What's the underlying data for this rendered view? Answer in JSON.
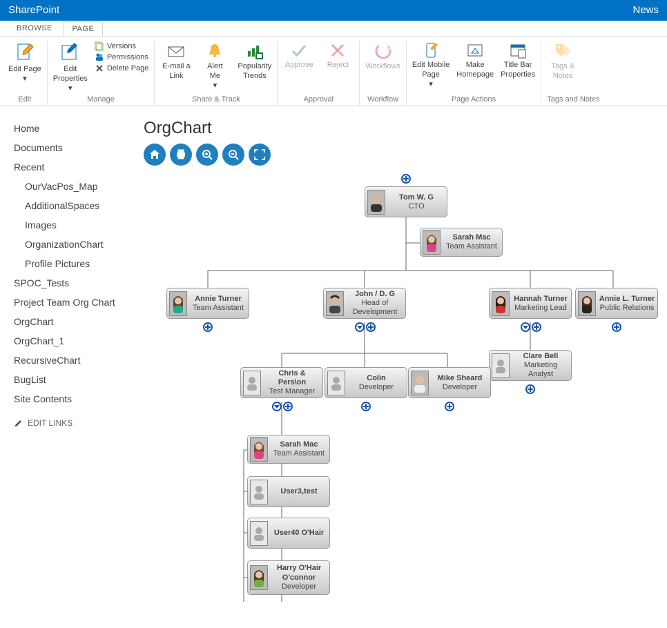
{
  "brand": "SharePoint",
  "topright": "News",
  "tabs": {
    "browse": "BROWSE",
    "page": "PAGE"
  },
  "ribbon": {
    "edit": {
      "label": "Edit",
      "editpage": "Edit Page"
    },
    "manage": {
      "label": "Manage",
      "editprops": "Edit\nProperties",
      "versions": "Versions",
      "permissions": "Permissions",
      "deletepage": "Delete Page"
    },
    "sharetrack": {
      "label": "Share & Track",
      "email": "E-mail a\nLink",
      "alert": "Alert\nMe",
      "trends": "Popularity\nTrends"
    },
    "approval": {
      "label": "Approval",
      "approve": "Approve",
      "reject": "Reject"
    },
    "workflow": {
      "label": "Workflow",
      "workflows": "Workflows"
    },
    "pageactions": {
      "label": "Page Actions",
      "mobile": "Edit Mobile\nPage",
      "homepage": "Make\nHomepage",
      "titlebar": "Title Bar\nProperties"
    },
    "tagsnotes": {
      "label": "Tags and Notes",
      "tags": "Tags &\nNotes"
    }
  },
  "sidebar": {
    "home": "Home",
    "documents": "Documents",
    "recent": "Recent",
    "recent_items": [
      "OurVacPos_Map",
      "AdditionalSpaces",
      "Images",
      "OrganizationChart",
      "Profile Pictures"
    ],
    "items": [
      "SPOC_Tests",
      "Project Team Org Chart",
      "OrgChart",
      "OrgChart_1",
      "RecursiveChart",
      "BugList",
      "Site Contents"
    ],
    "editlinks": "EDIT LINKS"
  },
  "page": {
    "title": "OrgChart"
  },
  "nodes": {
    "tom": {
      "name": "Tom W. G",
      "title": "CTO"
    },
    "sarah1": {
      "name": "Sarah Mac",
      "title": "Team Assistant"
    },
    "annie": {
      "name": "Annie Turner",
      "title": "Team Assistant"
    },
    "john": {
      "name": "John / D. G",
      "title": "Head of Development"
    },
    "hannah": {
      "name": "Hannah Turner",
      "title": "Marketing Lead"
    },
    "anniel": {
      "name": "Annie L. Turner",
      "title": "Public Relations"
    },
    "chris": {
      "name": "Chris & Pers\\on",
      "title": "Test Manager"
    },
    "colin": {
      "name": "Colin",
      "title": "Developer"
    },
    "mike": {
      "name": "Mike Sheard",
      "title": "Developer"
    },
    "clare": {
      "name": "Clare Bell",
      "title": "Marketing Analyst"
    },
    "sarah2": {
      "name": "Sarah Mac",
      "title": "Team Assistant"
    },
    "user3": {
      "name": "User3,test",
      "title": ""
    },
    "user40": {
      "name": "User40 O'Hair",
      "title": ""
    },
    "harry": {
      "name": "Harry O'Hair O'connor",
      "title": "Developer"
    }
  }
}
